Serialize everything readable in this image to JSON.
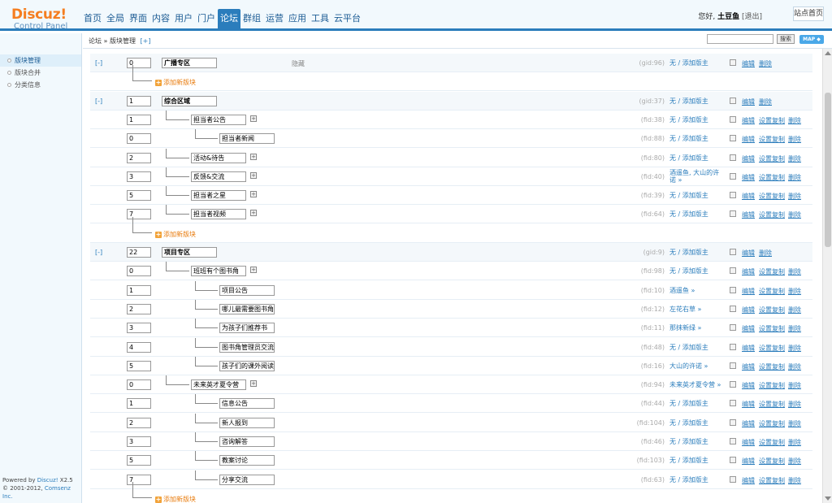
{
  "header": {
    "logo_brand": "Discuz!",
    "logo_sub": "Control Panel",
    "nav": [
      "首页",
      "全局",
      "界面",
      "内容",
      "用户",
      "门户",
      "论坛",
      "群组",
      "运营",
      "应用",
      "工具",
      "云平台"
    ],
    "nav_active": 6,
    "greeting": "您好,",
    "username": "土豆鱼",
    "logout": "[退出]",
    "site_home": "站点首页"
  },
  "sidebar": {
    "items": [
      "版块管理",
      "版块合并",
      "分类信息"
    ],
    "footer_line1_prefix": "Powered by ",
    "footer_line1_brand": "Discuz!",
    "footer_line1_version": " X2.5",
    "footer_line2_prefix": "© 2001-2012, ",
    "footer_line2_company": "Comsenz Inc."
  },
  "breadcrumb": {
    "path": "论坛 » 版块管理",
    "add": "[+]",
    "search_button": "搜索",
    "map_button": "MAP ◆"
  },
  "labels": {
    "collapse": "[-]",
    "hidden": "隐藏",
    "add_new": "添加新版块",
    "edit": "编辑",
    "copy_settings": "设置复制",
    "delete": "删除",
    "sub_plus": "+"
  },
  "rows": [
    {
      "kind": "group",
      "order": "0",
      "name": "广播专区",
      "id": "(gid:96)",
      "mod": "无 / 添加版主",
      "hidden": true
    },
    {
      "kind": "add",
      "level": 1
    },
    {
      "kind": "group",
      "order": "1",
      "name": "综合区域",
      "id": "(gid:37)",
      "mod": "无 / 添加版主"
    },
    {
      "kind": "forum",
      "level": 1,
      "order": "1",
      "name": "担当者公告",
      "id": "(fid:38)",
      "mod": "无 / 添加版主",
      "plus": true
    },
    {
      "kind": "forum",
      "level": 2,
      "order": "0",
      "name": "担当者新闻",
      "id": "(fid:88)",
      "mod": "无 / 添加版主"
    },
    {
      "kind": "forum",
      "level": 1,
      "order": "2",
      "name": "活动&待告",
      "id": "(fid:80)",
      "mod": "无 / 添加版主",
      "plus": true
    },
    {
      "kind": "forum",
      "level": 1,
      "order": "3",
      "name": "反馈&交流",
      "id": "(fid:40)",
      "mod": "酒遥鱼, 大山的许诺 »",
      "plus": true,
      "tall": true
    },
    {
      "kind": "forum",
      "level": 1,
      "order": "5",
      "name": "担当者之星",
      "id": "(fid:39)",
      "mod": "无 / 添加版主",
      "plus": true
    },
    {
      "kind": "forum",
      "level": 1,
      "order": "7",
      "name": "担当者视频",
      "id": "(fid:64)",
      "mod": "无 / 添加版主",
      "plus": true
    },
    {
      "kind": "add",
      "level": 1
    },
    {
      "kind": "group",
      "order": "22",
      "name": "项目专区",
      "id": "(gid:9)",
      "mod": "无 / 添加版主"
    },
    {
      "kind": "forum",
      "level": 1,
      "order": "0",
      "name": "班班有个图书角",
      "id": "(fid:98)",
      "mod": "无 / 添加版主",
      "plus": true
    },
    {
      "kind": "forum",
      "level": 2,
      "order": "1",
      "name": "项目公告",
      "id": "(fid:10)",
      "mod": "酒遥鱼 »"
    },
    {
      "kind": "forum",
      "level": 2,
      "order": "2",
      "name": "哪儿最需要图书角",
      "id": "(fid:12)",
      "mod": "左花右草 »"
    },
    {
      "kind": "forum",
      "level": 2,
      "order": "3",
      "name": "为孩子们推荐书",
      "id": "(fid:11)",
      "mod": "那抹新绿 »"
    },
    {
      "kind": "forum",
      "level": 2,
      "order": "4",
      "name": "图书角管理员交流",
      "id": "(fid:48)",
      "mod": "无 / 添加版主"
    },
    {
      "kind": "forum",
      "level": 2,
      "order": "5",
      "name": "孩子们的课外阅读",
      "id": "(fid:16)",
      "mod": "大山的许诺 »"
    },
    {
      "kind": "forum",
      "level": 1,
      "order": "0",
      "name": "未来英才夏令营",
      "id": "(fid:94)",
      "mod": "未来英才夏令营 »",
      "plus": true
    },
    {
      "kind": "forum",
      "level": 2,
      "order": "1",
      "name": "信息公告",
      "id": "(fid:44)",
      "mod": "无 / 添加版主"
    },
    {
      "kind": "forum",
      "level": 2,
      "order": "2",
      "name": "新人报到",
      "id": "(fid:104)",
      "mod": "无 / 添加版主"
    },
    {
      "kind": "forum",
      "level": 2,
      "order": "3",
      "name": "咨询解答",
      "id": "(fid:46)",
      "mod": "无 / 添加版主"
    },
    {
      "kind": "forum",
      "level": 2,
      "order": "5",
      "name": "教案讨论",
      "id": "(fid:103)",
      "mod": "无 / 添加版主"
    },
    {
      "kind": "forum",
      "level": 2,
      "order": "7",
      "name": "分享交流",
      "id": "(fid:63)",
      "mod": "无 / 添加版主"
    },
    {
      "kind": "add",
      "level": 1
    }
  ],
  "colors": {
    "accent": "#2b7dbc",
    "logo": "#f57e20",
    "add_link": "#e87b0c",
    "sidebar_bg": "#f2f9fd"
  }
}
